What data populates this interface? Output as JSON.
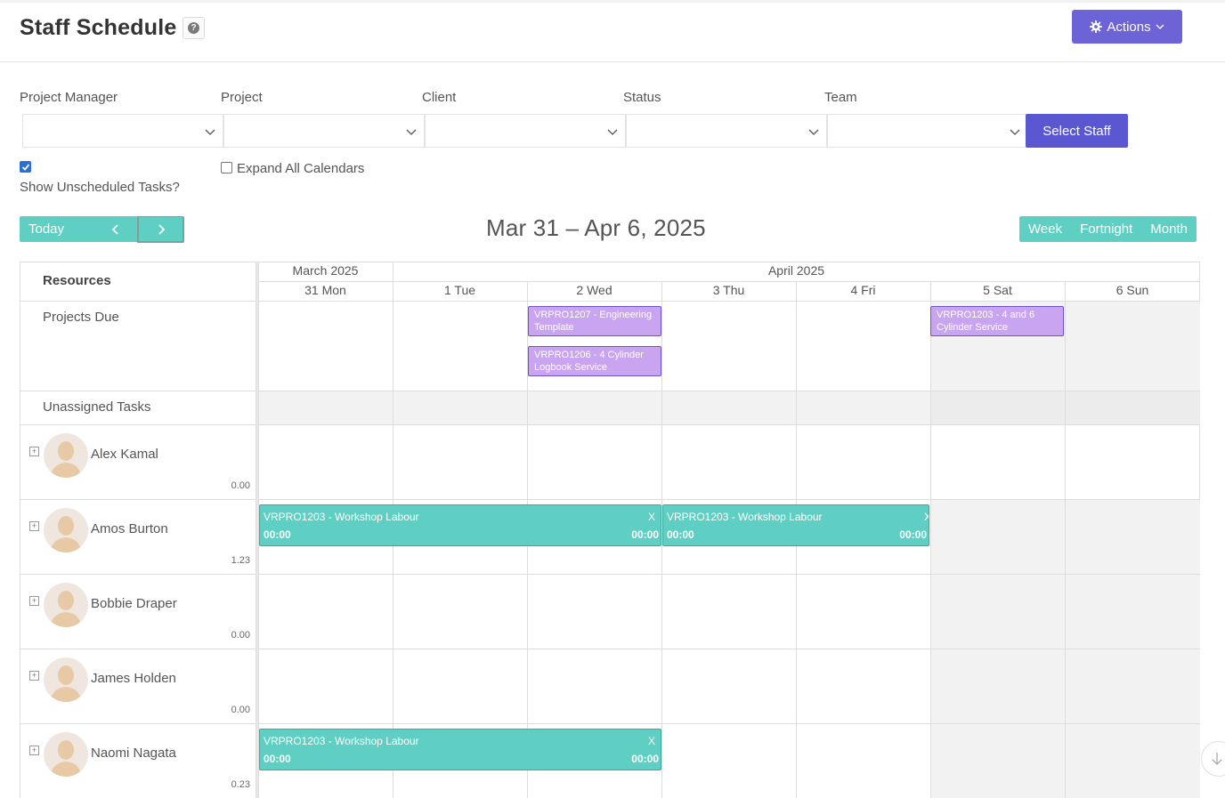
{
  "header": {
    "title": "Staff Schedule",
    "help_icon": "?",
    "actions_label": "Actions"
  },
  "filters": [
    {
      "label": "Project Manager",
      "value": ""
    },
    {
      "label": "Project",
      "value": ""
    },
    {
      "label": "Client",
      "value": ""
    },
    {
      "label": "Status",
      "value": ""
    },
    {
      "label": "Team",
      "value": ""
    }
  ],
  "select_staff_label": "Select Staff",
  "options": {
    "show_unscheduled_label": "Show Unscheduled Tasks?",
    "show_unscheduled_checked": true,
    "expand_all_label": "Expand All Calendars",
    "expand_all_checked": false
  },
  "toolbar": {
    "today_label": "Today",
    "range_title": "Mar 31 – Apr 6, 2025",
    "views": [
      "Week",
      "Fortnight",
      "Month"
    ]
  },
  "calendar": {
    "resources_header": "Resources",
    "months": [
      "March 2025",
      "April 2025"
    ],
    "days": [
      "31 Mon",
      "1 Tue",
      "2 Wed",
      "3 Thu",
      "4 Fri",
      "5 Sat",
      "6 Sun"
    ],
    "projects_due_label": "Projects Due",
    "unassigned_label": "Unassigned Tasks",
    "projects_due": [
      {
        "text": "VRPRO1207 - Engineering Template"
      },
      {
        "text": "VRPRO1206 - 4 Cylinder Logbook Service"
      },
      {
        "text": "VRPRO1203 - 4 and 6 Cylinder Service"
      }
    ],
    "staff": [
      {
        "name": "Alex Kamal",
        "hours": "0.00"
      },
      {
        "name": "Amos Burton",
        "hours": "1.23"
      },
      {
        "name": "Bobbie Draper",
        "hours": "0.00"
      },
      {
        "name": "James Holden",
        "hours": "0.00"
      },
      {
        "name": "Naomi Nagata",
        "hours": "0.23"
      }
    ],
    "tasks": [
      {
        "title": "VRPRO1203 - Workshop Labour",
        "close": "X",
        "start": "00:00",
        "end": "00:00"
      },
      {
        "title": "VRPRO1203 - Workshop Labour",
        "close": "X",
        "start": "00:00",
        "end": "00:00"
      },
      {
        "title": "VRPRO1203 - Workshop Labour",
        "close": "X",
        "start": "00:00",
        "end": "00:00"
      }
    ],
    "expand_icon": "+"
  },
  "colors": {
    "primary": "#6c63d6",
    "teal": "#5fcfc3",
    "purple_event": "#c9a4f0"
  }
}
